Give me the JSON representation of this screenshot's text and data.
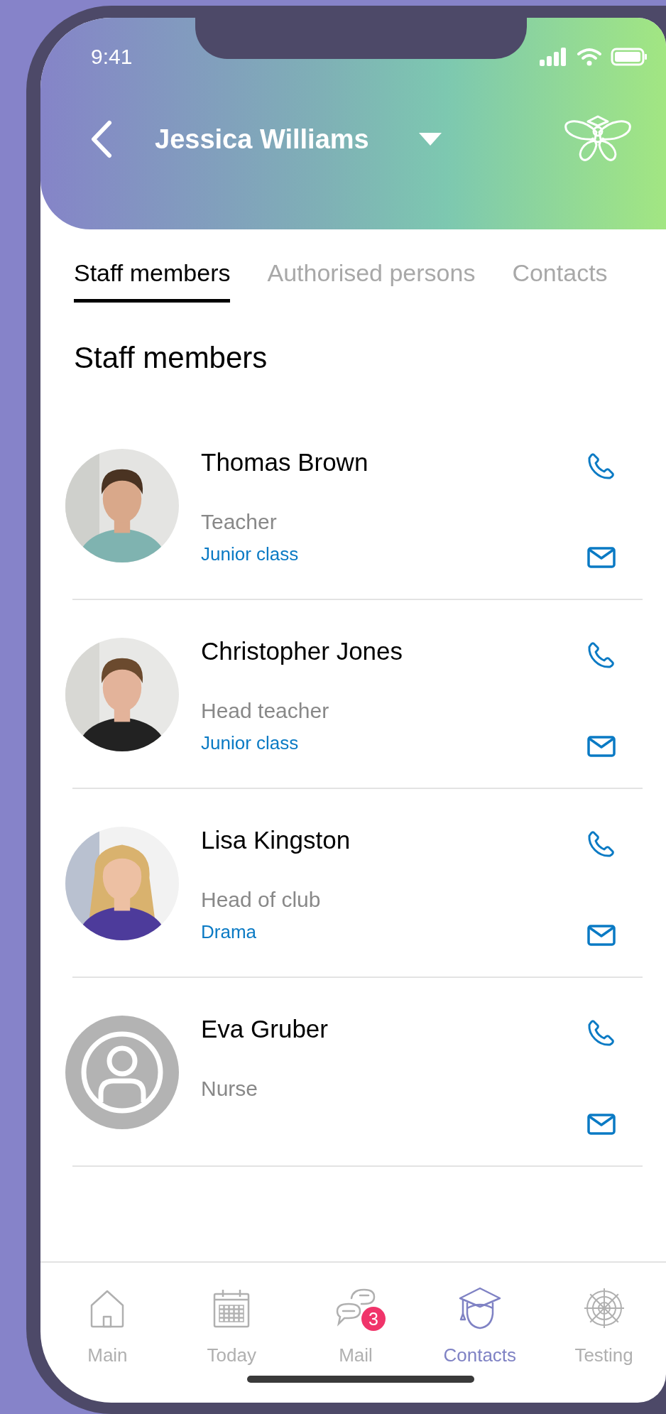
{
  "status_bar": {
    "time": "9:41"
  },
  "header": {
    "title": "Jessica Williams"
  },
  "tabs": [
    {
      "label": "Staff members",
      "selected": true
    },
    {
      "label": "Authorised persons",
      "selected": false
    },
    {
      "label": "Contacts",
      "selected": false
    }
  ],
  "section_title": "Staff members",
  "staff": [
    {
      "name": "Thomas Brown",
      "role": "Teacher",
      "group": "Junior class"
    },
    {
      "name": "Christopher Jones",
      "role": "Head teacher",
      "group": "Junior class"
    },
    {
      "name": "Lisa Kingston",
      "role": "Head of club",
      "group": "Drama"
    },
    {
      "name": "Eva Gruber",
      "role": "Nurse",
      "avatar": {
        "kind": "placeholder"
      }
    }
  ],
  "bottom_nav": [
    {
      "label": "Main",
      "selected": false
    },
    {
      "label": "Today",
      "selected": false
    },
    {
      "label": "Mail",
      "selected": false,
      "badge": "3"
    },
    {
      "label": "Contacts",
      "selected": true
    },
    {
      "label": "Testing",
      "selected": false
    }
  ]
}
